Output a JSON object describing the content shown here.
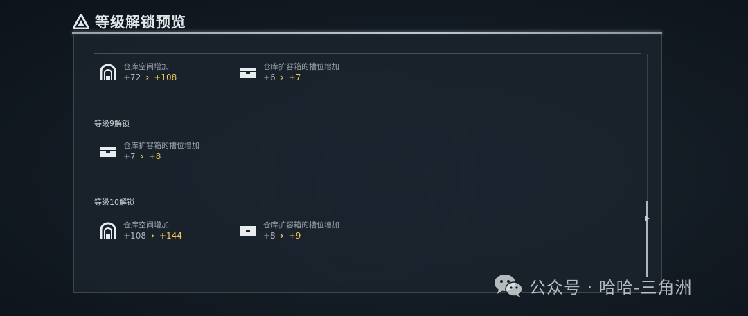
{
  "header": {
    "title": "等级解锁预览"
  },
  "sections": [
    {
      "label": "",
      "items": [
        {
          "icon": "warehouse-icon",
          "label": "仓库空间增加",
          "old": "+72",
          "new": "+108"
        },
        {
          "icon": "storage-box-icon",
          "label": "仓库扩容箱的槽位增加",
          "old": "+6",
          "new": "+7"
        }
      ]
    },
    {
      "label": "等级9解锁",
      "items": [
        {
          "icon": "storage-box-icon",
          "label": "仓库扩容箱的槽位增加",
          "old": "+7",
          "new": "+8"
        }
      ]
    },
    {
      "label": "等级10解锁",
      "items": [
        {
          "icon": "warehouse-icon",
          "label": "仓库空间增加",
          "old": "+108",
          "new": "+144"
        },
        {
          "icon": "storage-box-icon",
          "label": "仓库扩容箱的槽位增加",
          "old": "+8",
          "new": "+9"
        }
      ]
    }
  ],
  "watermark": {
    "text": "公众号 · 哈哈-三角洲"
  },
  "colors": {
    "accent": "#f0c75e",
    "panel": "#1b232d",
    "text": "#c9d0d6"
  }
}
